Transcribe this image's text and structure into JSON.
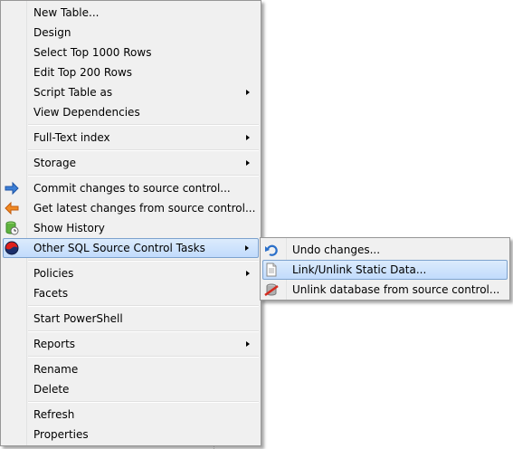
{
  "context_menu": {
    "items": [
      {
        "label": "New Table..."
      },
      {
        "label": "Design"
      },
      {
        "label": "Select Top 1000 Rows"
      },
      {
        "label": "Edit Top 200 Rows"
      },
      {
        "label": "Script Table as"
      },
      {
        "label": "View Dependencies"
      },
      {
        "label": "Full-Text index"
      },
      {
        "label": "Storage"
      },
      {
        "label": "Commit changes to source control...",
        "icon": "commit-arrow-icon"
      },
      {
        "label": "Get latest changes from source control...",
        "icon": "get-latest-arrow-icon"
      },
      {
        "label": "Show History",
        "icon": "history-database-icon"
      },
      {
        "label": "Other SQL Source Control Tasks",
        "icon": "redgate-logo-icon"
      },
      {
        "label": "Policies"
      },
      {
        "label": "Facets"
      },
      {
        "label": "Start PowerShell"
      },
      {
        "label": "Reports"
      },
      {
        "label": "Rename"
      },
      {
        "label": "Delete"
      },
      {
        "label": "Refresh"
      },
      {
        "label": "Properties"
      }
    ]
  },
  "submenu": {
    "items": [
      {
        "label": "Undo changes...",
        "icon": "undo-icon"
      },
      {
        "label": "Link/Unlink Static Data...",
        "icon": "document-icon"
      },
      {
        "label": "Unlink database from source control...",
        "icon": "unlink-database-icon"
      }
    ]
  },
  "colors": {
    "menu_background": "#f0f0f0",
    "highlight_top": "#dcebfc",
    "highlight_bottom": "#c1dbfc",
    "highlight_border": "#7da2ce"
  }
}
